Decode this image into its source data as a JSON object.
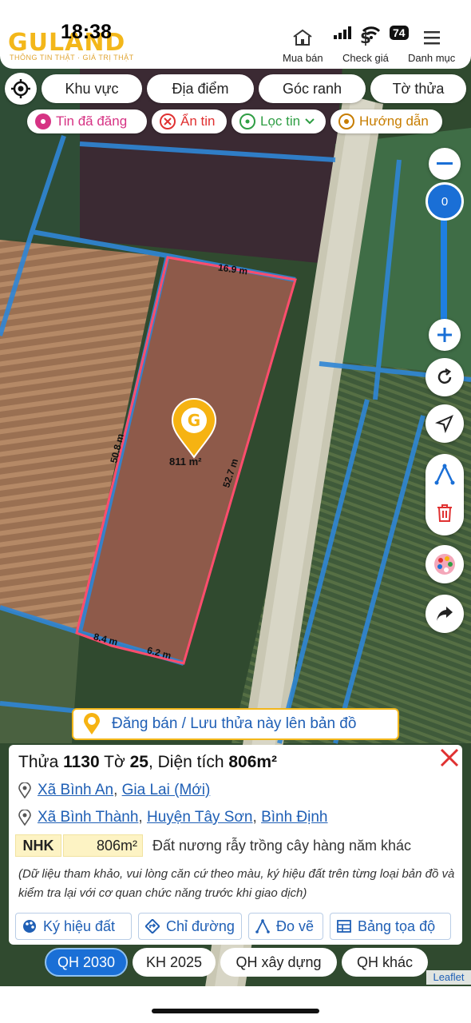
{
  "status": {
    "time": "18:38",
    "battery": "74"
  },
  "brand": {
    "logo": "GULAND",
    "tagline": "THÔNG TIN THẬT · GIÁ TRỊ THẬT"
  },
  "header_nav": [
    {
      "label": "Mua bán",
      "icon": "home-icon"
    },
    {
      "label": "Check giá",
      "icon": "price-check-icon"
    },
    {
      "label": "Danh mục",
      "icon": "menu-icon"
    }
  ],
  "filters": [
    "Khu vực",
    "Địa điểm",
    "Góc ranh",
    "Tờ thửa"
  ],
  "chips": [
    {
      "label": "Tin đã đăng",
      "icon": "posted-icon",
      "color": "#d63384"
    },
    {
      "label": "Ẩn tin",
      "icon": "hide-icon",
      "color": "#e03131"
    },
    {
      "label": "Lọc tin",
      "icon": "filter-icon",
      "color": "#2f9e44"
    },
    {
      "label": "Hướng dẫn",
      "icon": "guide-icon",
      "color": "#c77d00"
    }
  ],
  "zoom": {
    "value": "0"
  },
  "parcel": {
    "edges": {
      "top": "16.9 m",
      "left": "50.8 m",
      "right": "52.7 m",
      "bottom_left": "8.4 m",
      "bottom_right": "6.2 m"
    },
    "area_label": "811 m²",
    "boundary_color": "#ff4d6d"
  },
  "post_banner": "Đăng bán / Lưu thửa này lên bản đồ",
  "info": {
    "thua_label": "Thửa",
    "thua": "1130",
    "to_label": "Tờ",
    "to": "25",
    "dt_label": "Diện tích",
    "dt": "806m²",
    "new_location": [
      "Xã Bình An",
      "Gia Lai (Mới)"
    ],
    "old_location": [
      "Xã Bình Thành",
      "Huyện Tây Sơn",
      "Bình Định"
    ],
    "land_code": "NHK",
    "land_area": "806m²",
    "land_desc": "Đất nương rẫy trồng cây hàng năm khác",
    "disclaimer": "(Dữ liệu tham khảo, vui lòng căn cứ theo màu, ký hiệu đất trên từng loại bản đồ và kiểm tra lại với cơ quan chức năng trước khi giao dịch)",
    "tools": [
      "Ký hiệu đất",
      "Chỉ đường",
      "Đo vẽ",
      "Bảng tọa độ"
    ]
  },
  "plan_tabs": [
    "QH 2030",
    "KH 2025",
    "QH xây dựng",
    "QH khác"
  ],
  "active_tab": "QH 2030",
  "attribution": "Leaflet"
}
